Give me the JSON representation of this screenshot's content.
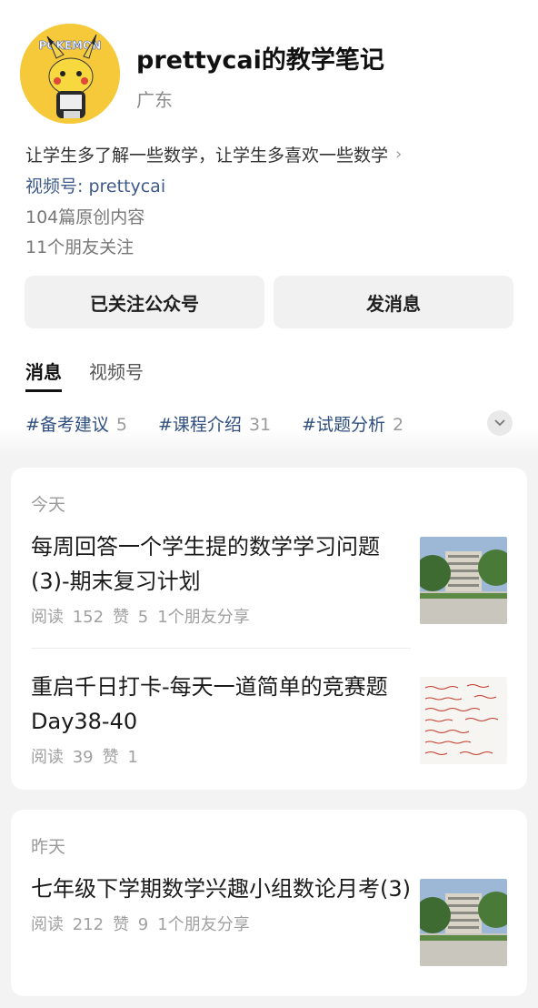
{
  "profile": {
    "name": "prettycai的教学笔记",
    "region": "广东",
    "bio": "让学生多了解一些数学，让学生多喜欢一些数学",
    "channel": "视频号: prettycai",
    "articles_count": "104篇原创内容",
    "friends_following": "11个朋友关注",
    "avatar_text": "POKEMON"
  },
  "actions": {
    "follow_label": "已关注公众号",
    "message_label": "发消息"
  },
  "tabs": [
    {
      "label": "消息",
      "active": true
    },
    {
      "label": "视频号",
      "active": false
    }
  ],
  "topics": [
    {
      "label": "#备考建议",
      "count": "5"
    },
    {
      "label": "#课程介绍",
      "count": "31"
    },
    {
      "label": "#试题分析",
      "count": "2"
    }
  ],
  "feed": [
    {
      "day": "今天",
      "articles": [
        {
          "title": "每周回答一个学生提的数学学习问题(3)-期末复习计划",
          "read": "阅读 152",
          "likes": "赞 5",
          "shares": "1个朋友分享",
          "thumb": "building"
        },
        {
          "title": "重启千日打卡-每天一道简单的竞赛题Day38-40",
          "read": "阅读 39",
          "likes": "赞 1",
          "shares": "",
          "thumb": "handwriting"
        }
      ]
    },
    {
      "day": "昨天",
      "articles": [
        {
          "title": "七年级下学期数学兴趣小组数论月考(3)",
          "read": "阅读 212",
          "likes": "赞 9",
          "shares": "1个朋友分享",
          "thumb": "building"
        }
      ]
    }
  ],
  "colors": {
    "link": "#3d5a8a",
    "topic": "#2f4f80",
    "avatar_bg": "#f6c93b"
  }
}
